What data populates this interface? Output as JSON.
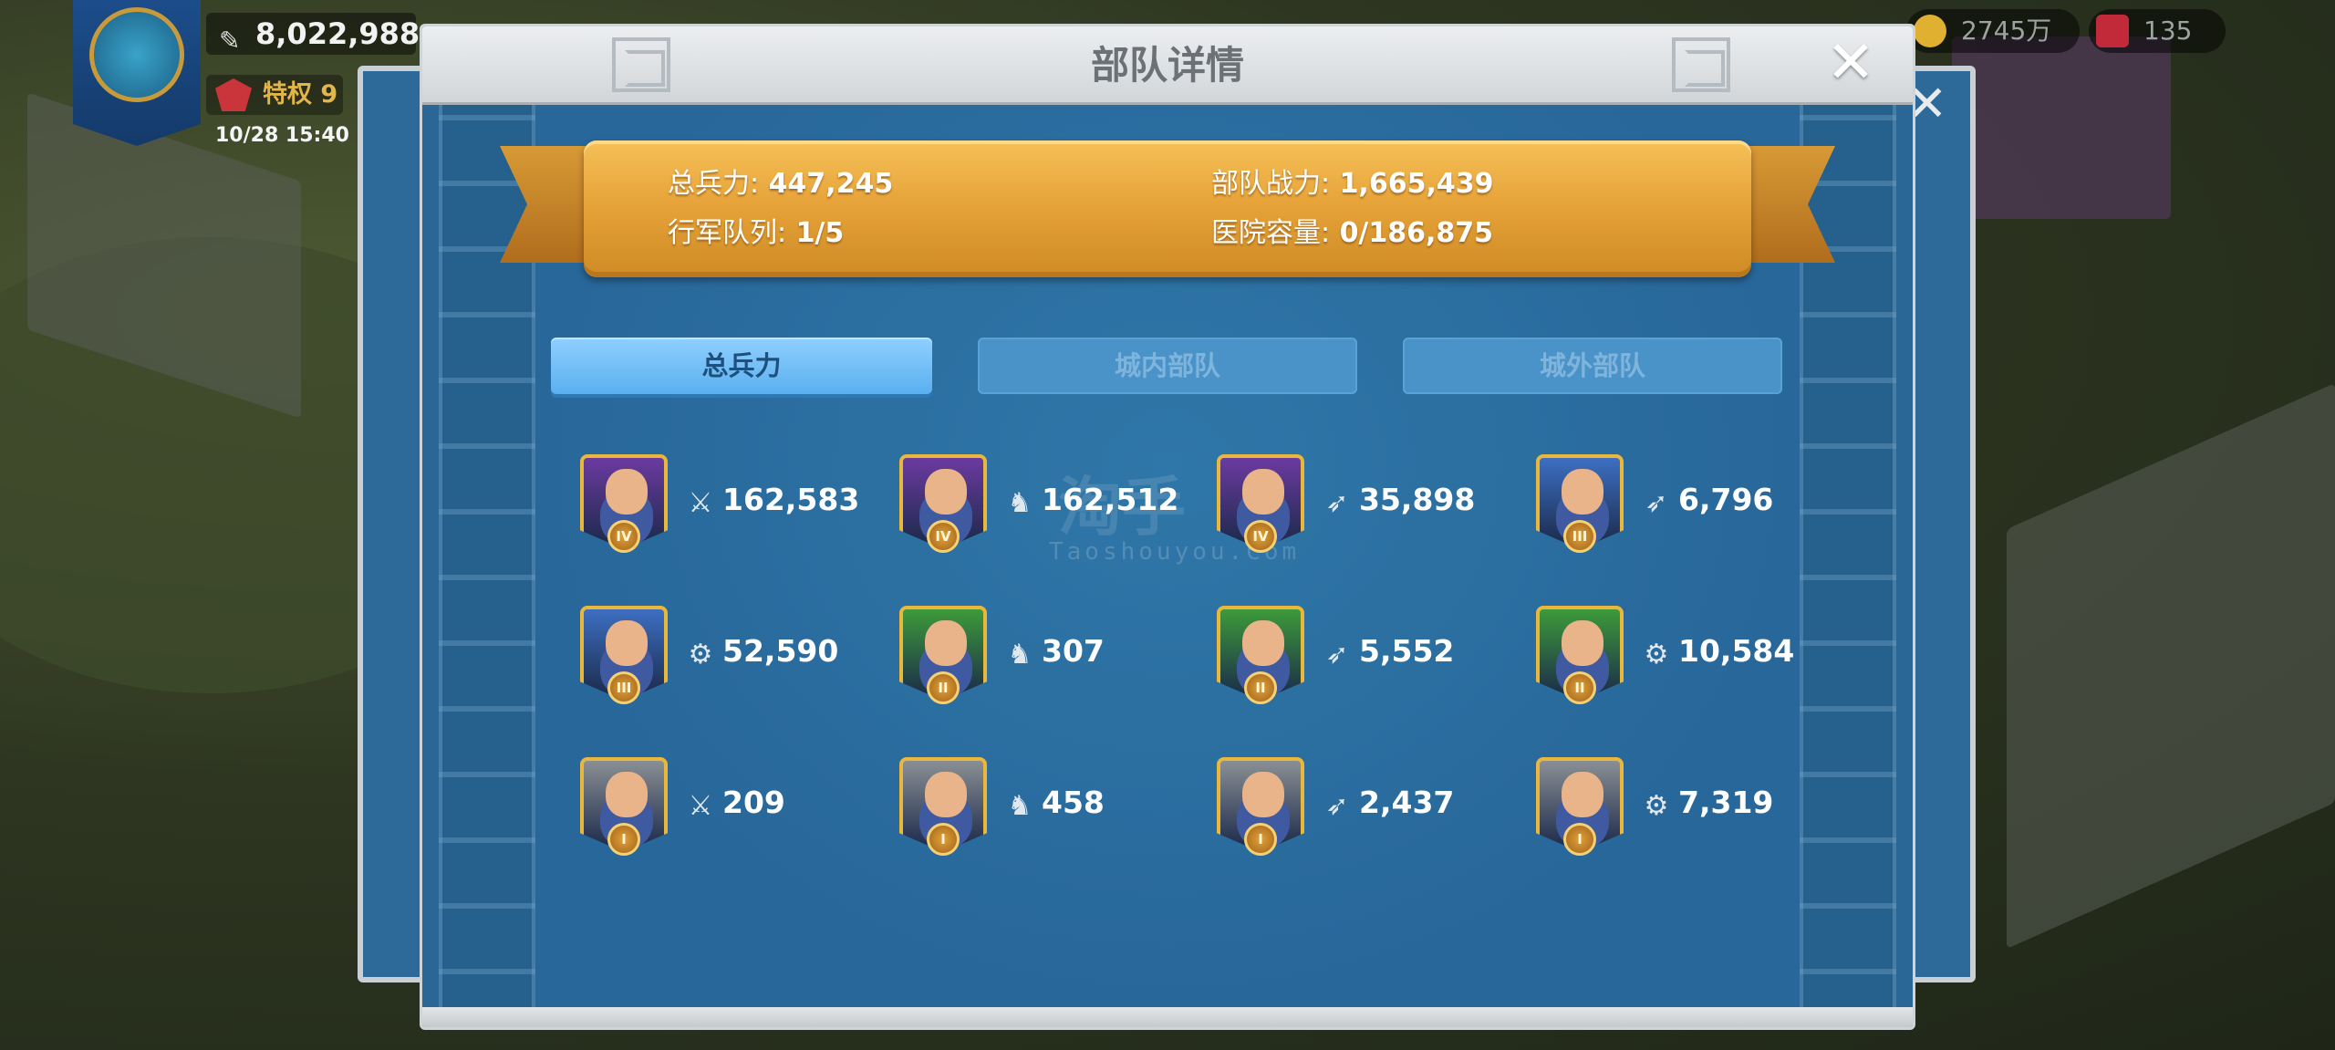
{
  "hud": {
    "power": "8,022,988",
    "vip_label": "特权 9",
    "datetime": "10/28 15:40",
    "gold": "2745万",
    "gems": "135"
  },
  "dialog": {
    "title": "部队详情",
    "close_symbol": "✕"
  },
  "summary": {
    "total_label": "总兵力:",
    "total_value": "447,245",
    "power_label": "部队战力:",
    "power_value": "1,665,439",
    "march_label": "行军队列:",
    "march_value": "1/5",
    "hospital_label": "医院容量:",
    "hospital_value": "0/186,875"
  },
  "tabs": [
    {
      "label": "总兵力",
      "active": true
    },
    {
      "label": "城内部队",
      "active": false
    },
    {
      "label": "城外部队",
      "active": false
    }
  ],
  "troops": [
    {
      "type": "infantry-icon",
      "tier": "IV",
      "count": "162,583",
      "color": "#6b3aa0"
    },
    {
      "type": "cavalry-icon",
      "tier": "IV",
      "count": "162,512",
      "color": "#6b3aa0"
    },
    {
      "type": "archer-icon",
      "tier": "IV",
      "count": "35,898",
      "color": "#6b3aa0"
    },
    {
      "type": "archer-icon",
      "tier": "III",
      "count": "6,796",
      "color": "#3d6fc2"
    },
    {
      "type": "siege-icon",
      "tier": "III",
      "count": "52,590",
      "color": "#3d6fc2"
    },
    {
      "type": "cavalry-icon",
      "tier": "II",
      "count": "307",
      "color": "#3d9a3a"
    },
    {
      "type": "archer-icon",
      "tier": "II",
      "count": "5,552",
      "color": "#3d9a3a"
    },
    {
      "type": "siege-icon",
      "tier": "II",
      "count": "10,584",
      "color": "#3d9a3a"
    },
    {
      "type": "infantry-icon",
      "tier": "I",
      "count": "209",
      "color": "#8a8f94"
    },
    {
      "type": "cavalry-icon",
      "tier": "I",
      "count": "458",
      "color": "#8a8f94"
    },
    {
      "type": "archer-icon",
      "tier": "I",
      "count": "2,437",
      "color": "#8a8f94"
    },
    {
      "type": "siege-icon",
      "tier": "I",
      "count": "7,319",
      "color": "#8a8f94"
    }
  ],
  "watermark": {
    "text": "Taoshouyou.Com",
    "big": "淘手"
  }
}
